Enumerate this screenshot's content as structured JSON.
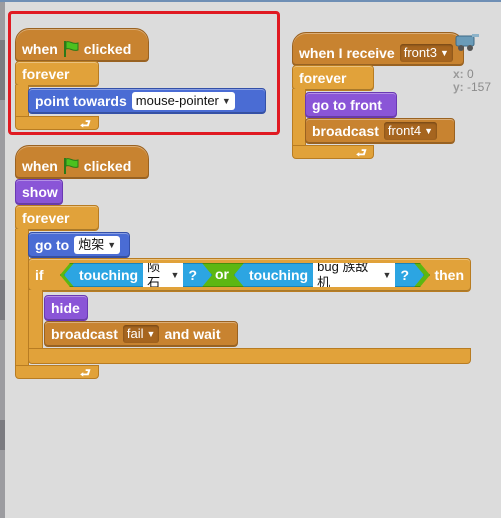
{
  "script1": {
    "hat_when": "when",
    "hat_clicked": "clicked",
    "forever": "forever",
    "point_towards": "point towards",
    "point_target": "mouse-pointer"
  },
  "script2": {
    "receive_label": "when I receive",
    "receive_message": "front3",
    "forever": "forever",
    "go_to_front": "go to front",
    "broadcast": "broadcast",
    "broadcast_message": "front4"
  },
  "sprite_info": {
    "x_label": "x:",
    "x_value": "0",
    "y_label": "y:",
    "y_value": "-157"
  },
  "script3": {
    "hat_when": "when",
    "hat_clicked": "clicked",
    "show": "show",
    "forever": "forever",
    "go_to": "go to",
    "go_to_target": "炮架",
    "if": "if",
    "touching1": "touching",
    "touching1_target": "陨石",
    "q1": "?",
    "or": "or",
    "touching2": "touching",
    "touching2_target": "bug 族敌机",
    "q2": "?",
    "then": "then",
    "hide": "hide",
    "broadcast_wait": "broadcast",
    "broadcast_wait_message": "fail",
    "and_wait": "and wait"
  },
  "colors": {
    "control": "#e1a23a",
    "motion": "#4a6cd4",
    "looks": "#8a55d7",
    "sensing": "#2ca5e2",
    "operators": "#5cb712",
    "events": "#c88330",
    "highlight": "#e01a22"
  },
  "icons": {
    "flag": "green-flag-icon",
    "loop": "loop-arrow-icon",
    "sprite_thumb": "sprite-thumbnail-icon"
  }
}
